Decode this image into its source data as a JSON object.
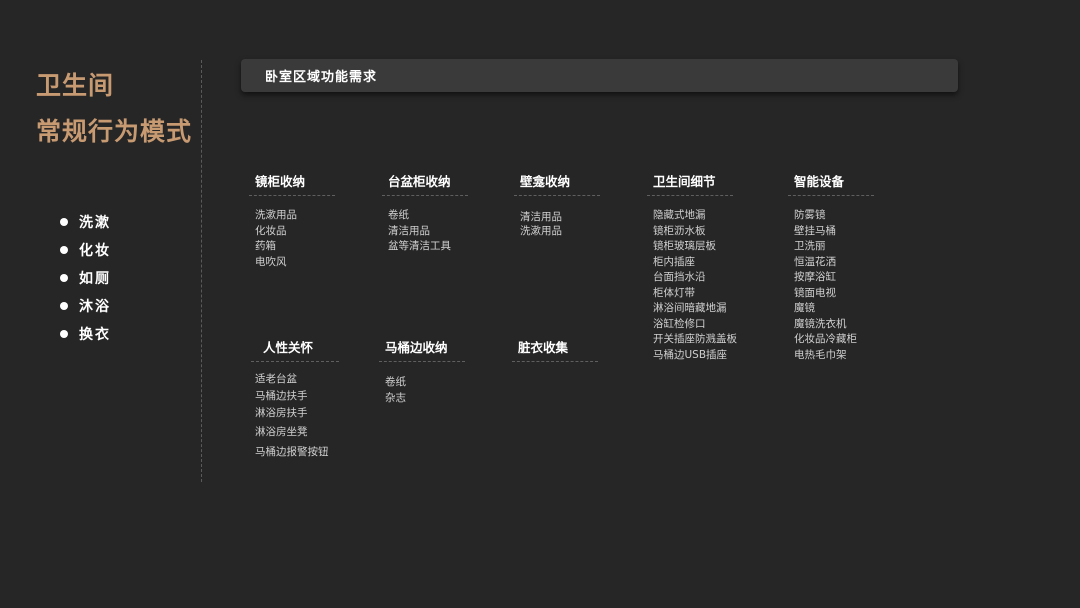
{
  "sidebar": {
    "title_line1": "卫生间",
    "title_line2": "常规行为模式",
    "bullets": [
      "洗漱",
      "化妆",
      "如厕",
      "沐浴",
      "换衣"
    ]
  },
  "section_header": "卧室区域功能需求",
  "categories": [
    {
      "title": "镜柜收纳",
      "items": [
        "洗漱用品",
        "化妆品",
        "药箱",
        "电吹风"
      ]
    },
    {
      "title": "台盆柜收纳",
      "items": [
        "卷纸",
        "清洁用品",
        "盆等清洁工具"
      ]
    },
    {
      "title": "壁龛收纳",
      "items": [
        "清洁用品",
        "洗漱用品"
      ]
    },
    {
      "title": "卫生间细节",
      "items": [
        "隐藏式地漏",
        "镜柜沥水板",
        "镜柜玻璃层板",
        "柜内插座",
        "台面挡水沿",
        "柜体灯带",
        "淋浴间暗藏地漏",
        "浴缸检修口",
        "开关插座防溅盖板",
        "马桶边USB插座"
      ]
    },
    {
      "title": "智能设备",
      "items": [
        "防雾镜",
        "壁挂马桶",
        "卫洗丽",
        "恒温花洒",
        "按摩浴缸",
        "镜面电视",
        "魔镜",
        "魔镜洗衣机",
        "化妆品冷藏柜",
        "电热毛巾架"
      ]
    },
    {
      "title": "人性关怀",
      "items": [
        "适老台盆",
        "马桶边扶手",
        "淋浴房扶手",
        "淋浴房坐凳",
        "马桶边报警按钮"
      ]
    },
    {
      "title": "马桶边收纳",
      "items": [
        "卷纸",
        "杂志"
      ]
    },
    {
      "title": "脏衣收集",
      "items": []
    }
  ]
}
